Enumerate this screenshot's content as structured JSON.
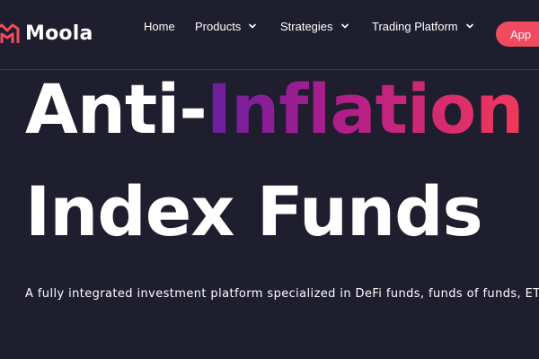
{
  "brand": {
    "name": "Moola",
    "accent": "#f24a5e",
    "background": "#1e1e2e"
  },
  "nav": {
    "home": "Home",
    "products": "Products",
    "strategies": "Strategies",
    "trading_platform": "Trading Platform",
    "app_button": "App",
    "dropdown_icon": "chevron-down-icon"
  },
  "hero": {
    "line1_part1": "Anti-",
    "line1_part2": "Inflation",
    "line2": "Index Funds",
    "subtitle": "A fully integrated investment platform specialized in DeFi funds, funds of funds, ET"
  },
  "colors": {
    "gradient_start": "#6a1fa0",
    "gradient_mid": "#b51e88",
    "gradient_end": "#f2395a"
  }
}
